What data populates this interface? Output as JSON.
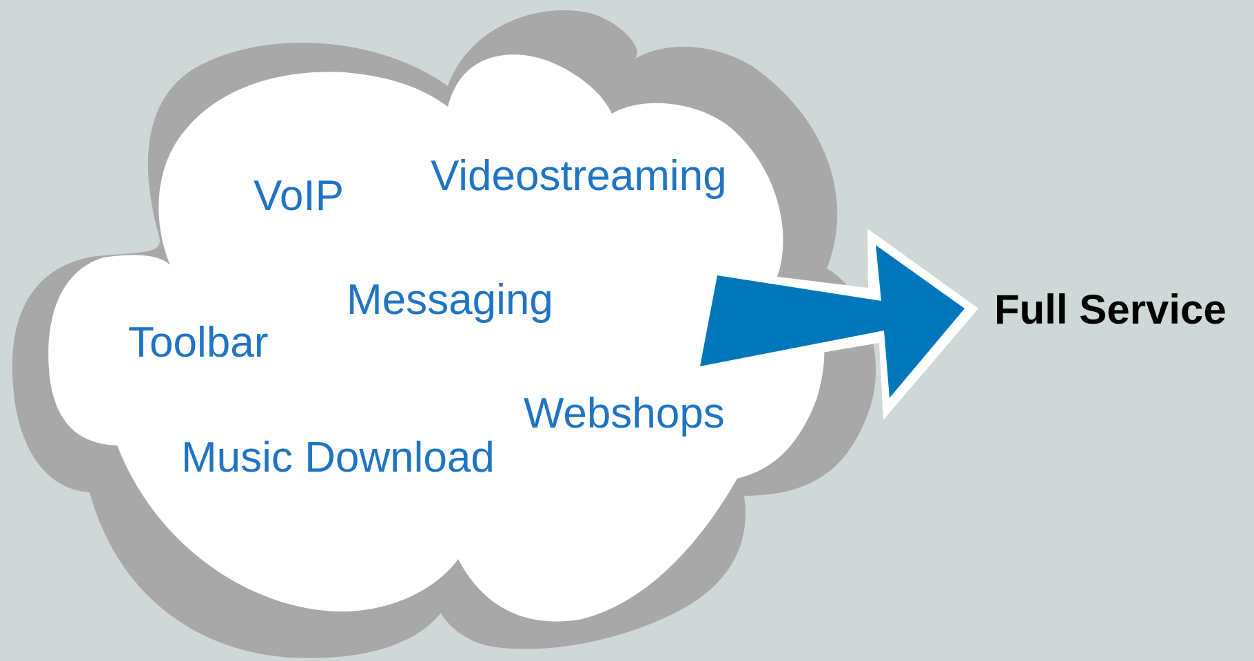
{
  "services": [
    {
      "label": "VoIP"
    },
    {
      "label": "Videostreaming"
    },
    {
      "label": "Messaging"
    },
    {
      "label": "Toolbar"
    },
    {
      "label": "Webshops"
    },
    {
      "label": "Music Download"
    }
  ],
  "result": {
    "label": "Full Service"
  },
  "colors": {
    "background": "#d0d7d7",
    "cloud_fill": "#ffffff",
    "cloud_shadow": "#a8a8a8",
    "service_text": "#1f74c4",
    "arrow": "#0077bb",
    "result_text": "#000000"
  }
}
